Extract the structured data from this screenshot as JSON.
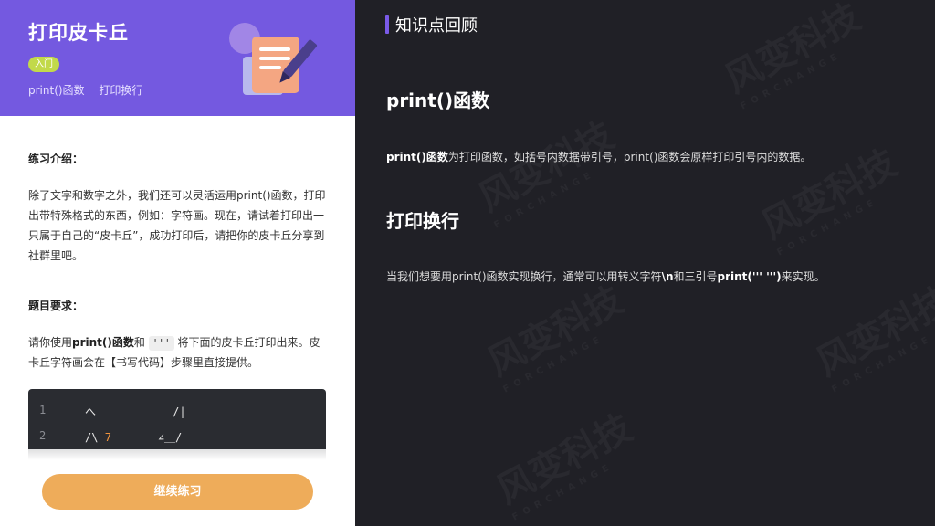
{
  "left": {
    "title": "打印皮卡丘",
    "badge": "入门",
    "tags": [
      "print()函数",
      "打印换行"
    ],
    "intro_label": "练习介绍：",
    "intro_text": "除了文字和数字之外，我们还可以灵活运用print()函数，打印出带特殊格式的东西，例如：字符画。现在，请试着打印出一只属于自己的“皮卡丘”，成功打印后，请把你的皮卡丘分享到社群里吧。",
    "req_label": "题目要求：",
    "req_text_1": "请你使用",
    "req_bold": "print()函数",
    "req_text_2": "和",
    "req_code": "'''",
    "req_text_3": "将下面的皮卡丘打印出来。皮卡丘字符画会在【书写代码】步骤里直接提供。",
    "code_lines": [
      {
        "num": "1",
        "text_a": "へ",
        "text_b": "",
        "text_c": "     /|"
      },
      {
        "num": "2",
        "text_a": "/\\",
        "text_b": "7",
        "text_c": "    ∠＿/"
      }
    ],
    "continue_label": "继续练习",
    "header_color": "#7459e0",
    "button_color": "#eeac5a"
  },
  "right": {
    "title": "知识点回顾",
    "section1_heading": "print()函数",
    "section1_bold": "print()函数",
    "section1_text": "为打印函数，如括号内数据带引号，print()函数会原样打印引号内的数据。",
    "section2_heading": "打印换行",
    "section2_text_1": "当我们想要用print()函数实现换行，通常可以用转义字符",
    "section2_bold_1": "\\n",
    "section2_text_2": "和三引号",
    "section2_bold_2": "print(''' ''')",
    "section2_text_3": "来实现。",
    "watermark_text": "风变科技",
    "watermark_sub": "FORCHANGE",
    "accent_color": "#7a5ae8"
  }
}
